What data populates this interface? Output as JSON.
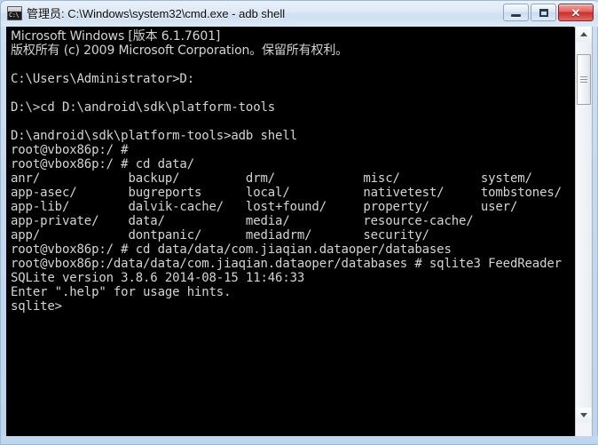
{
  "window": {
    "title": "管理员: C:\\Windows\\system32\\cmd.exe - adb  shell",
    "icon_name": "cmd-console-icon",
    "icon_text": "C:\\",
    "buttons": {
      "minimize": "─",
      "maximize": "□",
      "close": "✕"
    },
    "colors": {
      "titlebar": "#d2e2f2",
      "frame": "#bdd4ec",
      "close_button": "#cc2f2b",
      "console_bg": "#000000",
      "console_fg": "#d4d4d4"
    }
  },
  "scrollbar": {
    "up_arrow": "▲",
    "down_arrow": "▼",
    "thumb_position_pct": 4
  },
  "console": {
    "font_size_px": 14,
    "line_height_px": 16,
    "lines": [
      "Microsoft Windows [版本 6.1.7601]",
      "版权所有 (c) 2009 Microsoft Corporation。保留所有权利。",
      "",
      "C:\\Users\\Administrator>D:",
      "",
      "D:\\>cd D:\\android\\sdk\\platform-tools",
      "",
      "D:\\android\\sdk\\platform-tools>adb shell",
      "root@vbox86p:/ #",
      "root@vbox86p:/ # cd data/",
      "anr/            backup/         drm/            misc/           system/",
      "app-asec/       bugreports      local/          nativetest/     tombstones/",
      "app-lib/        dalvik-cache/   lost+found/     property/       user/",
      "app-private/    data/           media/          resource-cache/",
      "app/            dontpanic/      mediadrm/       security/",
      "root@vbox86p:/ # cd data/data/com.jiaqian.dataoper/databases",
      "root@vbox86p:/data/data/com.jiaqian.dataoper/databases # sqlite3 FeedReader",
      "SQLite version 3.8.6 2014-08-15 11:46:33",
      "Enter \".help\" for usage hints.",
      "sqlite>"
    ],
    "cjk_line_indexes": [
      0,
      1
    ],
    "directory_listing": {
      "command": "cd data/",
      "columns": 5,
      "entries": [
        [
          "anr/",
          "backup/",
          "drm/",
          "misc/",
          "system/"
        ],
        [
          "app-asec/",
          "bugreports",
          "local/",
          "nativetest/",
          "tombstones/"
        ],
        [
          "app-lib/",
          "dalvik-cache/",
          "lost+found/",
          "property/",
          "user/"
        ],
        [
          "app-private/",
          "data/",
          "media/",
          "resource-cache/",
          ""
        ],
        [
          "app/",
          "dontpanic/",
          "mediadrm/",
          "security/",
          ""
        ]
      ]
    },
    "sqlite": {
      "version": "3.8.6",
      "build_date": "2014-08-15 11:46:33",
      "database": "FeedReader",
      "prompt": "sqlite>"
    }
  }
}
